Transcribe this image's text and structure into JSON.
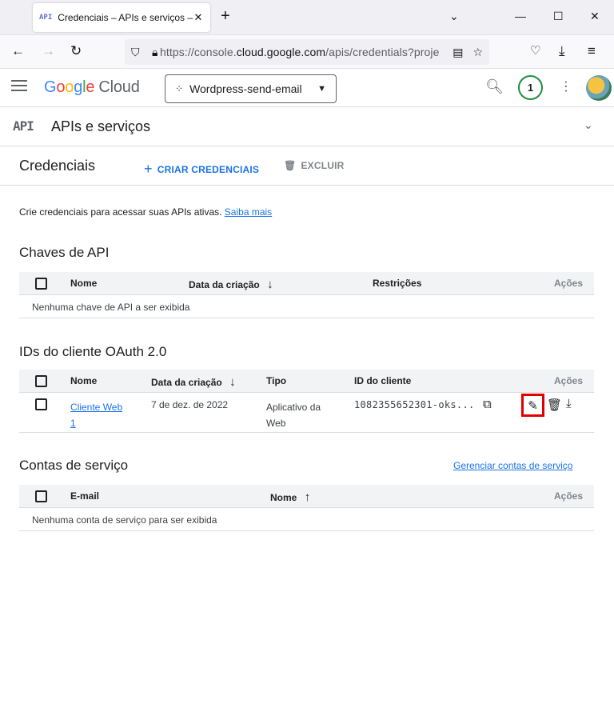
{
  "browser": {
    "tab_title": "Credenciais – APIs e serviços – W",
    "tab_favicon": "API",
    "url_prefix": "https://console.",
    "url_domain": "cloud.google.com",
    "url_rest": "/apis/credentials?proje"
  },
  "header": {
    "logo_cloud": "Cloud",
    "project_name": "Wordpress-send-email",
    "notification_count": "1"
  },
  "subheader": {
    "icon_text": "API",
    "title": "APIs e serviços"
  },
  "toolbar": {
    "title": "Credenciais",
    "create_label": "CRIAR CREDENCIAIS",
    "delete_label": "EXCLUIR"
  },
  "intro": {
    "text": "Crie credenciais para acessar suas APIs ativas.",
    "link": "Saiba mais"
  },
  "api_keys": {
    "title": "Chaves de API",
    "columns": [
      "Nome",
      "Data da criação",
      "Restrições",
      "Ações"
    ],
    "empty": "Nenhuma chave de API a ser exibida"
  },
  "oauth": {
    "title": "IDs do cliente OAuth 2.0",
    "columns": [
      "Nome",
      "Data da criação",
      "Tipo",
      "ID do cliente",
      "Ações"
    ],
    "rows": [
      {
        "name_line1": "Cliente Web",
        "name_line2": "1",
        "date": "7 de dez. de 2022",
        "type_line1": "Aplicativo da",
        "type_line2": "Web",
        "client_id": "1082355652301-oks..."
      }
    ]
  },
  "service_accounts": {
    "title": "Contas de serviço",
    "manage_link": "Gerenciar contas de serviço",
    "columns": [
      "E-mail",
      "Nome",
      "Ações"
    ],
    "empty": "Nenhuma conta de serviço para ser exibida"
  }
}
